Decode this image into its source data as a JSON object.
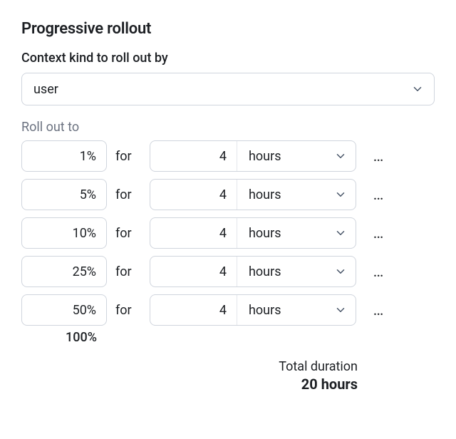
{
  "title": "Progressive rollout",
  "context_kind": {
    "label": "Context kind to roll out by",
    "value": "user"
  },
  "rollout": {
    "label": "Roll out to",
    "for_label": "for",
    "steps": [
      {
        "percent": "1%",
        "duration_value": "4",
        "duration_unit": "hours"
      },
      {
        "percent": "5%",
        "duration_value": "4",
        "duration_unit": "hours"
      },
      {
        "percent": "10%",
        "duration_value": "4",
        "duration_unit": "hours"
      },
      {
        "percent": "25%",
        "duration_value": "4",
        "duration_unit": "hours"
      },
      {
        "percent": "50%",
        "duration_value": "4",
        "duration_unit": "hours"
      }
    ],
    "final_percent": "100%"
  },
  "total": {
    "label": "Total duration",
    "value": "20 hours"
  },
  "icons": {
    "more": "…"
  }
}
